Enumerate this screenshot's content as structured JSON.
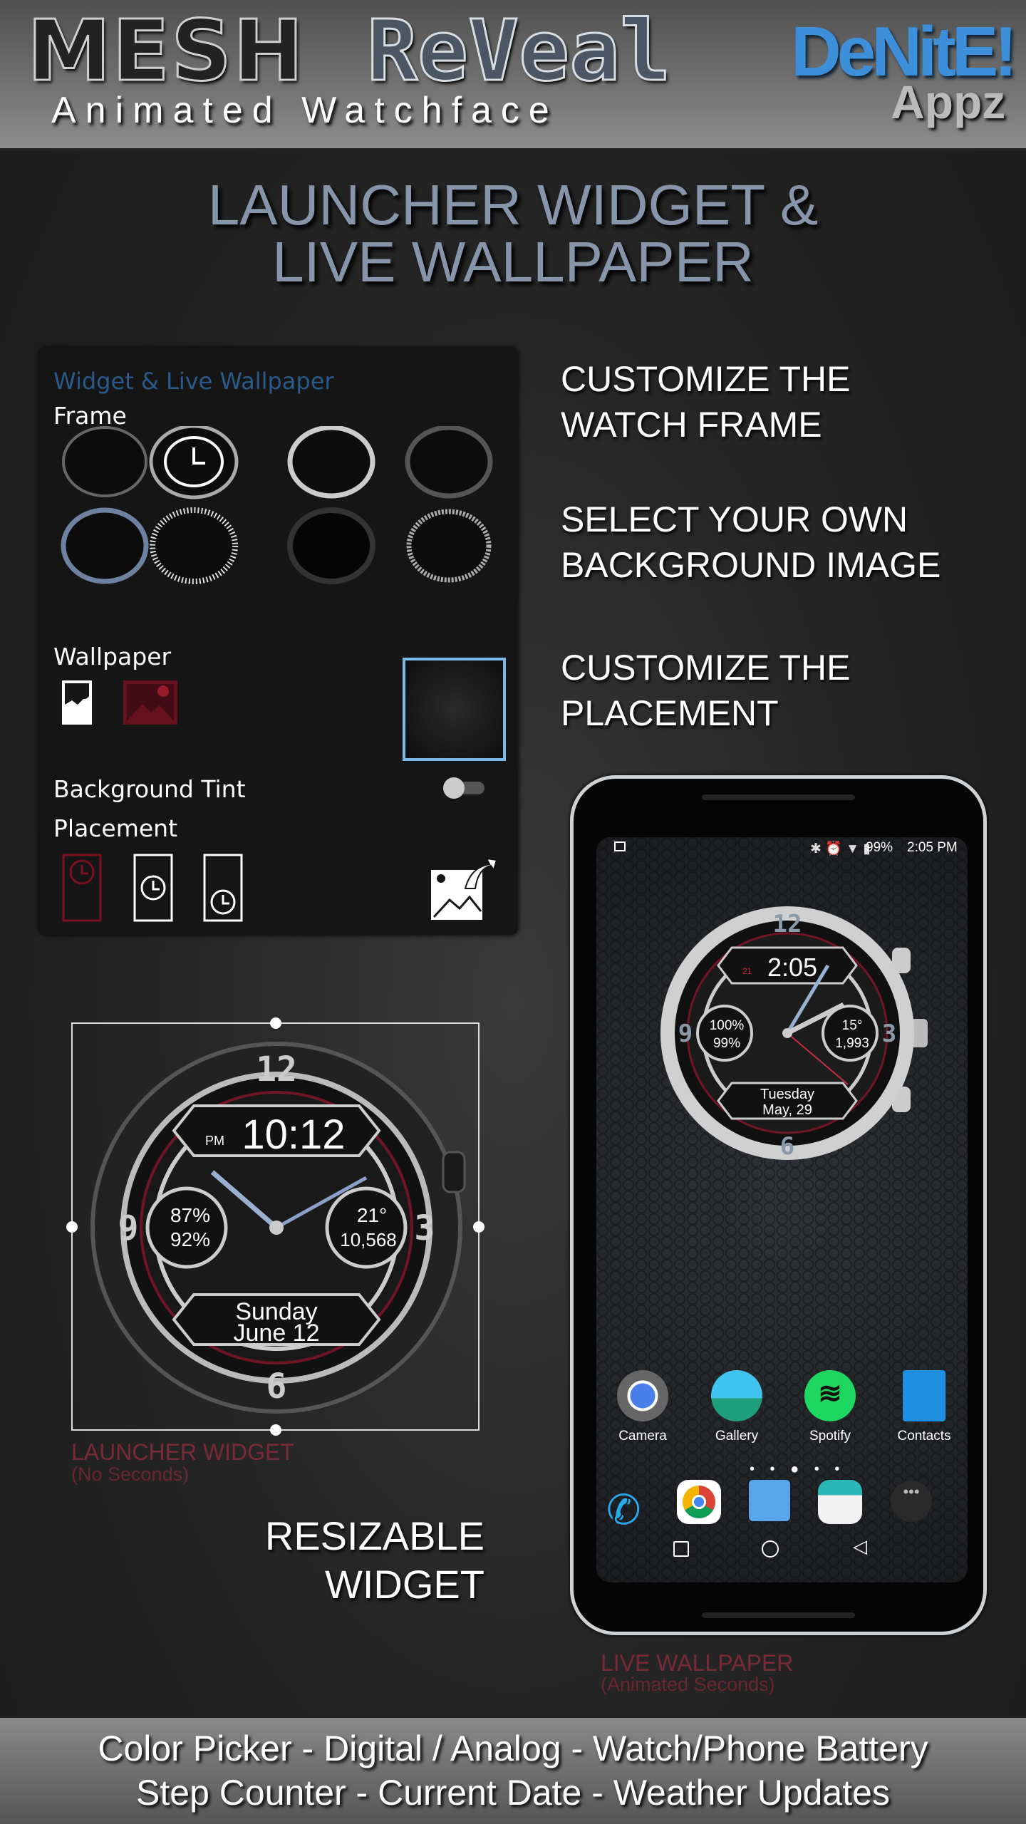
{
  "header": {
    "logo_word1": "MESH",
    "logo_word2": "ReVeal",
    "subtitle": "Animated Watchface",
    "brand": "DeNitE!",
    "brand_sub": "Appz"
  },
  "title": {
    "line1": "LAUNCHER WIDGET &",
    "line2": "LIVE WALLPAPER"
  },
  "panel": {
    "heading": "Widget & Live Wallpaper",
    "frame_label": "Frame",
    "wallpaper_label": "Wallpaper",
    "tint_label": "Background Tint",
    "tint_on": false,
    "placement_label": "Placement",
    "accent": "#2a5a8a",
    "selected_border": "#7ab8e8"
  },
  "features": [
    {
      "line1": "CUSTOMIZE THE",
      "line2": "WATCH FRAME"
    },
    {
      "line1": "SELECT YOUR OWN",
      "line2": "BACKGROUND IMAGE"
    },
    {
      "line1": "CUSTOMIZE THE",
      "line2": "PLACEMENT"
    }
  ],
  "widget": {
    "ampm": "PM",
    "time": "10:12",
    "watch_battery": "87%",
    "phone_battery": "92%",
    "temp": "21°",
    "steps": "10,568",
    "day": "Sunday",
    "date": "June 12",
    "caption": "LAUNCHER WIDGET",
    "caption_sub": "(No Seconds)"
  },
  "resizable": {
    "line1": "RESIZABLE",
    "line2": "WIDGET"
  },
  "phone": {
    "status": {
      "battery": "99%",
      "time": "2:05 PM"
    },
    "watch": {
      "day_num": "21",
      "time": "2:05",
      "watch_battery": "100%",
      "phone_battery": "99%",
      "temp": "15°",
      "steps": "1,993",
      "day": "Tuesday",
      "date": "May, 29"
    },
    "apps": [
      {
        "label": "Camera"
      },
      {
        "label": "Gallery"
      },
      {
        "label": "Spotify"
      },
      {
        "label": "Contacts"
      }
    ],
    "caption": "LIVE WALLPAPER",
    "caption_sub": "(Animated Seconds)"
  },
  "footer": {
    "line1": "Color Picker - Digital / Analog - Watch/Phone Battery",
    "line2": "Step Counter - Current Date - Weather Updates"
  }
}
